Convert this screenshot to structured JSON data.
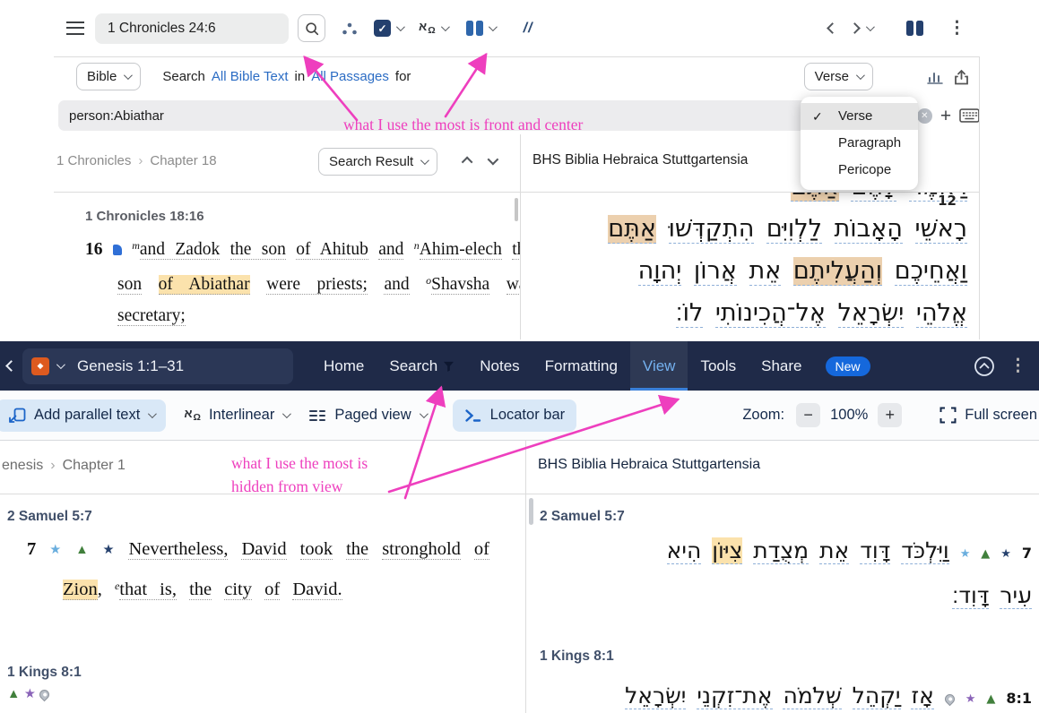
{
  "annotation": {
    "color": "#ee3fbe",
    "top_note": "what I use the most is front and center",
    "bottom_note_line1": "what I use the most is",
    "bottom_note_line2": "hidden from view"
  },
  "old_ui": {
    "toolbar": {
      "reference": "1 Chronicles 24:6",
      "slashes": "//"
    },
    "row2": {
      "bible": "Bible",
      "search_word": "Search",
      "all_bible_text": "All Bible Text",
      "in_word": "in",
      "all_passages": "All Passages",
      "for_word": "for",
      "verse": "Verse"
    },
    "search_input": {
      "value": "person:Abiathar"
    },
    "result_menu": {
      "items": [
        {
          "label": "Verse"
        },
        {
          "label": "Paragraph"
        },
        {
          "label": "Pericope"
        }
      ]
    },
    "left_pane": {
      "bc_book": "1 Chronicles",
      "bc_sep": "›",
      "bc_chapter": "Chapter 18",
      "search_result": "Search Result",
      "heading": "1 Chronicles 18:16",
      "verse_segments": [
        {
          "t": "16",
          "vn": true
        },
        {
          "icon": "note"
        },
        {
          "t": "m",
          "sup": true
        },
        {
          "t": "and Zadok",
          "u": true,
          "glue": true
        },
        {
          "t": "the son",
          "u": true
        },
        {
          "t": "of Ahitub",
          "u": true
        },
        {
          "t": "and",
          "u": true
        },
        {
          "t": "n",
          "sup": true
        },
        {
          "t": "Ahim-elech",
          "u": true,
          "glue": true
        },
        {
          "t": "the son",
          "u": true
        },
        {
          "t": "of Abiathar",
          "u": true,
          "hl": true
        },
        {
          "t": "were priests;",
          "u": true
        },
        {
          "t": "and",
          "u": true
        },
        {
          "t": "o",
          "sup": true
        },
        {
          "t": "Shavsha",
          "u": true,
          "glue": true
        },
        {
          "t": "was secretary;",
          "u": true
        }
      ]
    },
    "right_pane": {
      "title": "BHS Biblia Hebraica Stuttgartensia",
      "verse_number": "12",
      "line0": [
        {
          "t": "וַיֹּאמֶר",
          "u": true
        },
        {
          "t": "לָהֶם",
          "u": true
        },
        {
          "t": "אַתֶּם",
          "u": true,
          "hl2": true
        }
      ],
      "line1": [
        {
          "t": "רָאשֵׁי",
          "u": true
        },
        {
          "t": "הָאָבוֹת",
          "u": true
        },
        {
          "t": "לַלְוִיִּם",
          "u": true
        },
        {
          "t": "הִתְקַדְּשׁוּ",
          "u": true
        },
        {
          "t": "אַתֶּם",
          "u": true,
          "hl2": true
        }
      ],
      "line2": [
        {
          "t": "וַאֲחֵיכֶם",
          "u": true
        },
        {
          "t": "וְהַעֲלִיתֶם",
          "u": true,
          "hl2": true
        },
        {
          "t": "אֵת",
          "u": true
        },
        {
          "t": "אֲרוֹן",
          "u": true
        },
        {
          "t": "יְהוָה",
          "u": true
        }
      ],
      "line3": [
        {
          "t": "אֱלֹהֵי",
          "u": true
        },
        {
          "t": "יִשְׂרָאֵל",
          "u": true
        },
        {
          "t": "אֶל־הֲכִינוֹתִי",
          "u": true
        },
        {
          "t": "לוֹ׃",
          "u": true
        }
      ]
    }
  },
  "new_ui": {
    "topbar": {
      "reference": "Genesis 1:1–31",
      "tabs": [
        {
          "label": "Home"
        },
        {
          "label": "Search"
        },
        {
          "label": "Notes"
        },
        {
          "label": "Formatting"
        },
        {
          "label": "View"
        },
        {
          "label": "Tools"
        },
        {
          "label": "Share"
        }
      ],
      "new_badge": "New"
    },
    "toolbar": {
      "add_parallel": "Add parallel text",
      "interlinear": "Interlinear",
      "paged_view": "Paged view",
      "locator": "Locator bar",
      "zoom_label": "Zoom:",
      "minus": "−",
      "zoom_value": "100%",
      "plus": "+",
      "full_screen": "Full screen"
    },
    "headers": {
      "bc_book": "enesis",
      "bc_sep": "›",
      "bc_chapter": "Chapter 1",
      "right_title": "BHS Biblia Hebraica Stuttgartensia"
    },
    "left_pane": {
      "heading1": "2 Samuel 5:7",
      "verse_segments": [
        {
          "t": "7",
          "vn": true
        },
        {
          "icon": "star-lightblue"
        },
        {
          "icon": "triangle-green"
        },
        {
          "icon": "star-navy"
        },
        {
          "t": "Nevertheless,",
          "u": true
        },
        {
          "t": "David",
          "u": true
        },
        {
          "t": "took",
          "u": true
        },
        {
          "t": "the",
          "u": true
        },
        {
          "t": "stronghold",
          "u": true
        },
        {
          "t": "of",
          "u": true
        },
        {
          "t": "Zion",
          "u": true,
          "hl": true
        },
        {
          "t": ",",
          "glue": true
        },
        {
          "t": "e",
          "sup": true
        },
        {
          "t": "that is,",
          "u": true,
          "glue": true
        },
        {
          "t": "the",
          "u": true
        },
        {
          "t": "city",
          "u": true
        },
        {
          "t": "of",
          "u": true
        },
        {
          "t": "David.",
          "u": true
        }
      ],
      "heading2": "1 Kings 8:1",
      "icon_row": [
        {
          "icon": "triangle-green"
        },
        {
          "icon": "star-purple"
        },
        {
          "icon": "pin"
        }
      ]
    },
    "right_pane": {
      "heading1": "2 Samuel 5:7",
      "line1": [
        {
          "t": "7",
          "vn": true
        },
        {
          "icon": "star-navy"
        },
        {
          "icon": "triangle-green"
        },
        {
          "icon": "star-lightblue"
        },
        {
          "t": "וַיִּלְכֹּד",
          "u": true
        },
        {
          "t": "דָּוִד",
          "u": true
        },
        {
          "t": "אֵת",
          "u": true
        },
        {
          "t": "מְצֻדַת",
          "u": true
        },
        {
          "t": "צִיּוֹן",
          "u": true,
          "hl": true
        },
        {
          "t": "הִיא",
          "u": true
        }
      ],
      "line2": [
        {
          "t": "עִיר",
          "u": true
        },
        {
          "t": "דָּוִד׃",
          "u": true
        }
      ],
      "heading2": "1 Kings 8:1",
      "line3": [
        {
          "t": "8:1",
          "vn": true
        },
        {
          "icon": "triangle-green"
        },
        {
          "icon": "star-purple"
        },
        {
          "icon": "pin"
        },
        {
          "t": "אָז",
          "u": true
        },
        {
          "t": "יַקְהֵל",
          "u": true
        },
        {
          "t": "שְׁלֹמֹה",
          "u": true
        },
        {
          "t": "אֶת־זִקְנֵי",
          "u": true
        },
        {
          "t": "יִשְׂרָאֵל",
          "u": true
        }
      ]
    }
  }
}
